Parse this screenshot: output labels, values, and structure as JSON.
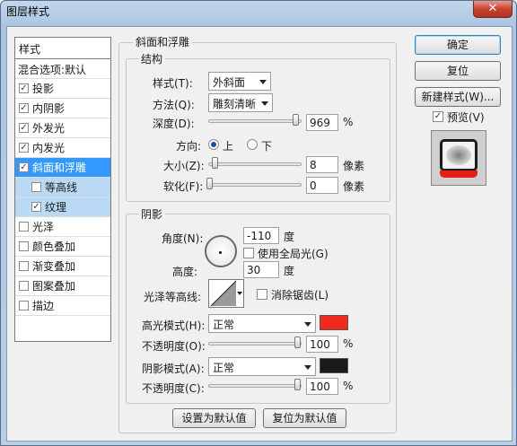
{
  "window": {
    "title": "图层样式",
    "close_glyph": "✕"
  },
  "left_panel": {
    "header": "样式",
    "blend_options": "混合选项:默认",
    "items": [
      {
        "label": "投影",
        "checked": true,
        "state": "normal"
      },
      {
        "label": "内阴影",
        "checked": true,
        "state": "normal"
      },
      {
        "label": "外发光",
        "checked": true,
        "state": "normal"
      },
      {
        "label": "内发光",
        "checked": true,
        "state": "normal"
      },
      {
        "label": "斜面和浮雕",
        "checked": true,
        "state": "selected"
      },
      {
        "label": "等高线",
        "checked": false,
        "state": "sub"
      },
      {
        "label": "纹理",
        "checked": true,
        "state": "sub"
      },
      {
        "label": "光泽",
        "checked": false,
        "state": "normal"
      },
      {
        "label": "颜色叠加",
        "checked": false,
        "state": "normal"
      },
      {
        "label": "渐变叠加",
        "checked": false,
        "state": "normal"
      },
      {
        "label": "图案叠加",
        "checked": false,
        "state": "normal"
      },
      {
        "label": "描边",
        "checked": false,
        "state": "normal"
      }
    ]
  },
  "bevel": {
    "title": "斜面和浮雕",
    "structure": {
      "title": "结构",
      "style_label": "样式(T):",
      "style_value": "外斜面",
      "technique_label": "方法(Q):",
      "technique_value": "雕刻清晰",
      "depth_label": "深度(D):",
      "depth_value": "969",
      "depth_unit": "%",
      "depth_level": 0.97,
      "direction_label": "方向:",
      "direction_up": "上",
      "direction_down": "下",
      "direction_selected": "上",
      "size_label": "大小(Z):",
      "size_value": "8",
      "size_unit": "像素",
      "size_level": 0.02,
      "soften_label": "软化(F):",
      "soften_value": "0",
      "soften_unit": "像素",
      "soften_level": 0.0
    },
    "shading": {
      "title": "阴影",
      "angle_label": "角度(N):",
      "angle_value": "-110",
      "angle_unit": "度",
      "global_light_label": "使用全局光(G)",
      "global_light_checked": false,
      "altitude_label": "高度:",
      "altitude_value": "30",
      "altitude_unit": "度",
      "gloss_label": "光泽等高线:",
      "antialias_label": "消除锯齿(L)",
      "antialias_checked": false,
      "highlight_mode_label": "高光模式(H):",
      "highlight_mode_value": "正常",
      "highlight_color": "#f02a1c",
      "highlight_opacity_label": "不透明度(O):",
      "highlight_opacity_value": "100",
      "highlight_opacity_unit": "%",
      "shadow_mode_label": "阴影模式(A):",
      "shadow_mode_value": "正常",
      "shadow_color": "#1a1a1a",
      "shadow_opacity_label": "不透明度(C):",
      "shadow_opacity_value": "100",
      "shadow_opacity_unit": "%"
    },
    "set_default_label": "设置为默认值",
    "reset_default_label": "复位为默认值"
  },
  "right_panel": {
    "ok_label": "确定",
    "reset_label": "复位",
    "new_style_label": "新建样式(W)...",
    "preview_label": "预览(V)",
    "preview_checked": true
  }
}
